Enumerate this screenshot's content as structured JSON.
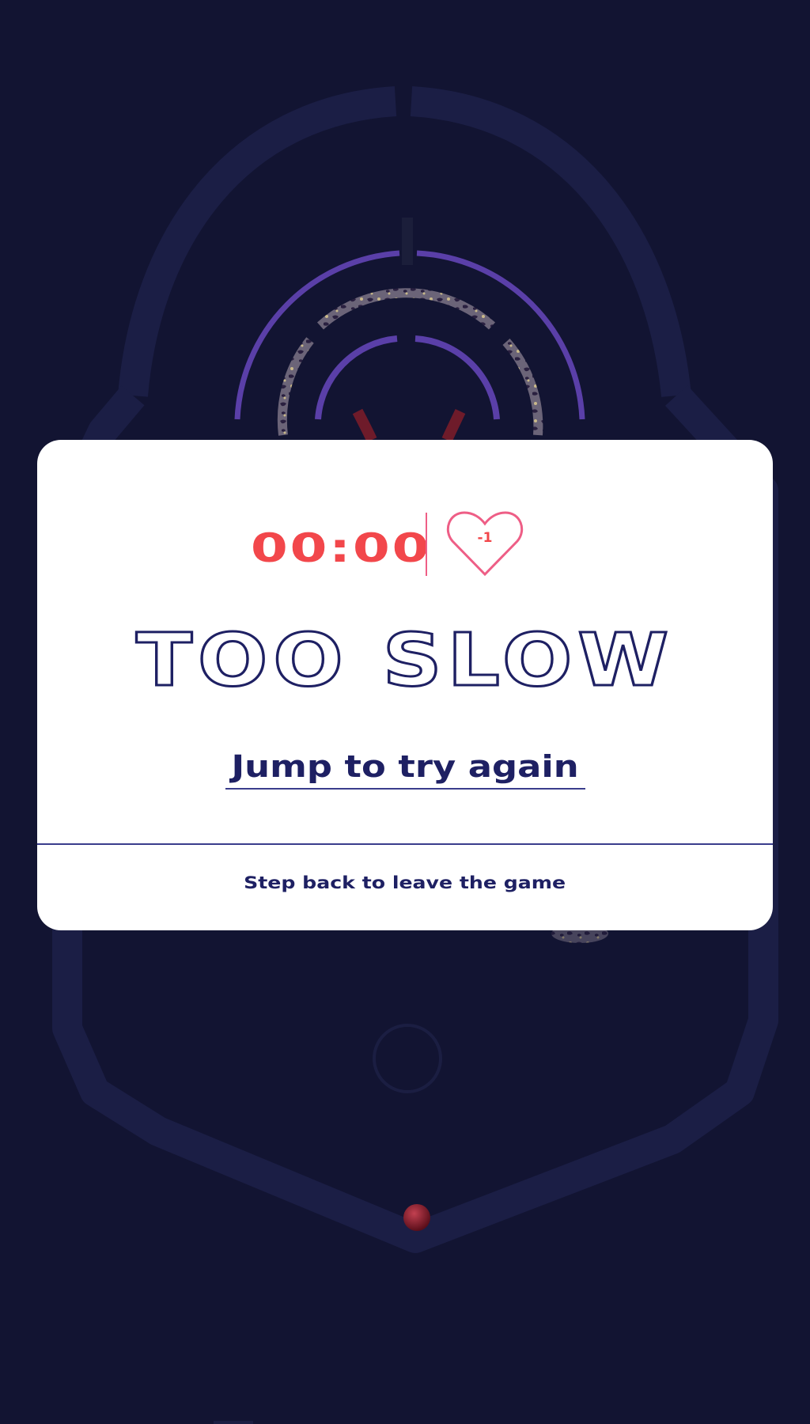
{
  "hud": {
    "timer": "00:00",
    "life_change": "-1"
  },
  "result": {
    "headline": "TOO SLOW",
    "retry_label": "Jump to try again",
    "leave_label": "Step back to leave the game"
  },
  "colors": {
    "background": "#121432",
    "modal": "#ffffff",
    "navy": "#1e2063",
    "timer_red": "#f2474b",
    "heart_pink": "#ee5e86",
    "ring_purple": "#5a3fa8",
    "track": "#1b1e45",
    "ball": "#8a1b2a"
  },
  "icons": {
    "life": "heart-outline-icon",
    "ball": "ball-icon"
  }
}
